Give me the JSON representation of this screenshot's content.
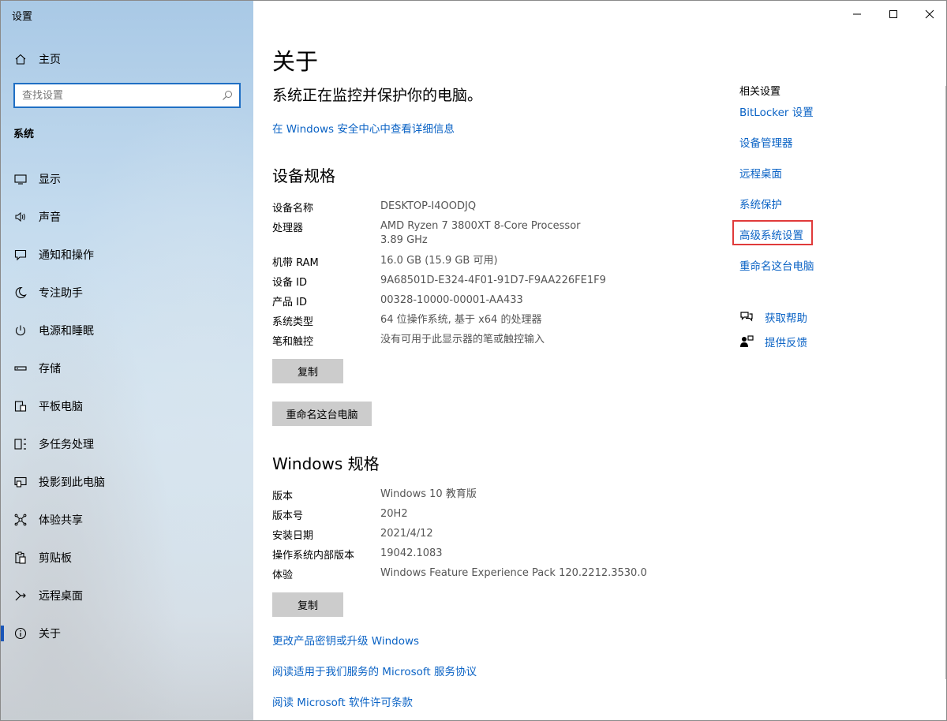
{
  "app": {
    "title": "设置"
  },
  "sidebar": {
    "home_label": "主页",
    "search_placeholder": "查找设置",
    "section_label": "系统",
    "items": [
      {
        "label": "显示",
        "icon": "monitor-icon"
      },
      {
        "label": "声音",
        "icon": "speaker-icon"
      },
      {
        "label": "通知和操作",
        "icon": "notification-icon"
      },
      {
        "label": "专注助手",
        "icon": "moon-icon"
      },
      {
        "label": "电源和睡眠",
        "icon": "power-icon"
      },
      {
        "label": "存储",
        "icon": "storage-icon"
      },
      {
        "label": "平板电脑",
        "icon": "tablet-icon"
      },
      {
        "label": "多任务处理",
        "icon": "multitask-icon"
      },
      {
        "label": "投影到此电脑",
        "icon": "projection-icon"
      },
      {
        "label": "体验共享",
        "icon": "share-icon"
      },
      {
        "label": "剪贴板",
        "icon": "clipboard-icon"
      },
      {
        "label": "远程桌面",
        "icon": "remote-desktop-icon"
      },
      {
        "label": "关于",
        "icon": "info-icon",
        "active": true
      }
    ]
  },
  "main": {
    "title": "关于",
    "status": "系统正在监控并保护你的电脑。",
    "security_link": "在 Windows 安全中心中查看详细信息",
    "device_specs": {
      "heading": "设备规格",
      "rows": [
        {
          "key": "设备名称",
          "value": "DESKTOP-I4OODJQ"
        },
        {
          "key": "处理器",
          "value": "AMD Ryzen 7 3800XT 8-Core Processor",
          "value2": "3.89 GHz"
        },
        {
          "key": "机带 RAM",
          "value": "16.0 GB (15.9 GB 可用)"
        },
        {
          "key": "设备 ID",
          "value": "9A68501D-E324-4F01-91D7-F9AA226FE1F9"
        },
        {
          "key": "产品 ID",
          "value": "00328-10000-00001-AA433"
        },
        {
          "key": "系统类型",
          "value": "64 位操作系统, 基于 x64 的处理器"
        },
        {
          "key": "笔和触控",
          "value": "没有可用于此显示器的笔或触控输入"
        }
      ],
      "copy_label": "复制",
      "rename_label": "重命名这台电脑"
    },
    "windows_specs": {
      "heading": "Windows 规格",
      "rows": [
        {
          "key": "版本",
          "value": "Windows 10 教育版"
        },
        {
          "key": "版本号",
          "value": "20H2"
        },
        {
          "key": "安装日期",
          "value": "2021/4/12"
        },
        {
          "key": "操作系统内部版本",
          "value": "19042.1083"
        },
        {
          "key": "体验",
          "value": "Windows Feature Experience Pack 120.2212.3530.0"
        }
      ],
      "copy_label": "复制"
    },
    "bottom_links": [
      "更改产品密钥或升级 Windows",
      "阅读适用于我们服务的 Microsoft 服务协议",
      "阅读 Microsoft 软件许可条款"
    ]
  },
  "related": {
    "title": "相关设置",
    "links": [
      "BitLocker 设置",
      "设备管理器",
      "远程桌面",
      "系统保护",
      "高级系统设置",
      "重命名这台电脑"
    ],
    "highlighted": "高级系统设置"
  },
  "help": {
    "get_help": "获取帮助",
    "feedback": "提供反馈"
  },
  "colors": {
    "accent": "#0b63c5",
    "highlight": "#e03a3a",
    "active_bar": "#1a56b8"
  }
}
